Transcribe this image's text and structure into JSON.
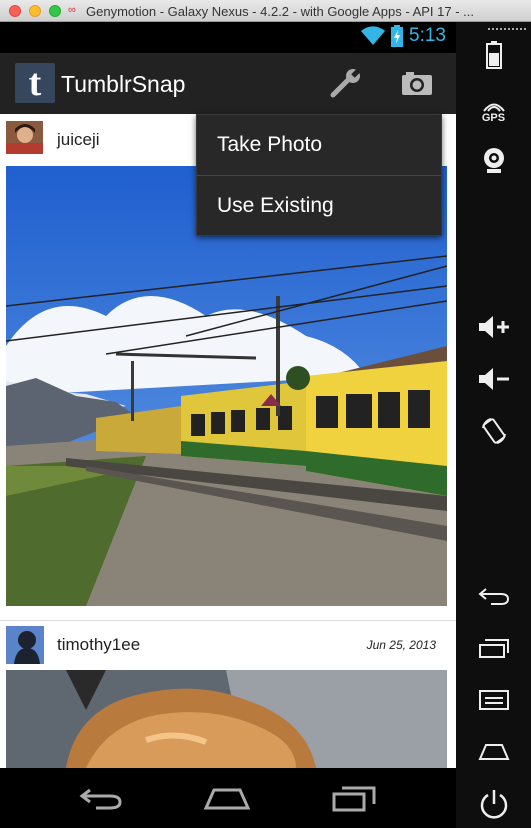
{
  "window": {
    "title": "Genymotion - Galaxy Nexus - 4.2.2 - with Google Apps - API 17 - ...",
    "title_icon": "∞"
  },
  "statusbar": {
    "time": "5:13",
    "accent": "#33b5e5",
    "icons": [
      "wifi-icon",
      "battery-charging-icon"
    ]
  },
  "actionbar": {
    "app_logo_letter": "t",
    "app_name": "TumblrSnap",
    "actions": [
      "wrench-icon",
      "camera-icon"
    ]
  },
  "menu": {
    "items": [
      {
        "label": "Take Photo"
      },
      {
        "label": "Use Existing"
      }
    ]
  },
  "posts": [
    {
      "username": "juiceji",
      "date": "",
      "photo": "train-landscape"
    },
    {
      "username": "timothy1ee",
      "date": "Jun 25, 2013",
      "photo": "dog-on-bed"
    }
  ],
  "side_panel": {
    "gps_label": "GPS",
    "buttons": [
      "battery-icon",
      "gps-icon",
      "webcam-icon",
      "volume-up-icon",
      "volume-down-icon",
      "rotate-icon",
      "back-icon",
      "recent-apps-icon",
      "menu-icon",
      "home-icon",
      "power-icon"
    ]
  },
  "navbar": {
    "buttons": [
      "back-icon",
      "home-icon",
      "recent-apps-icon"
    ]
  }
}
